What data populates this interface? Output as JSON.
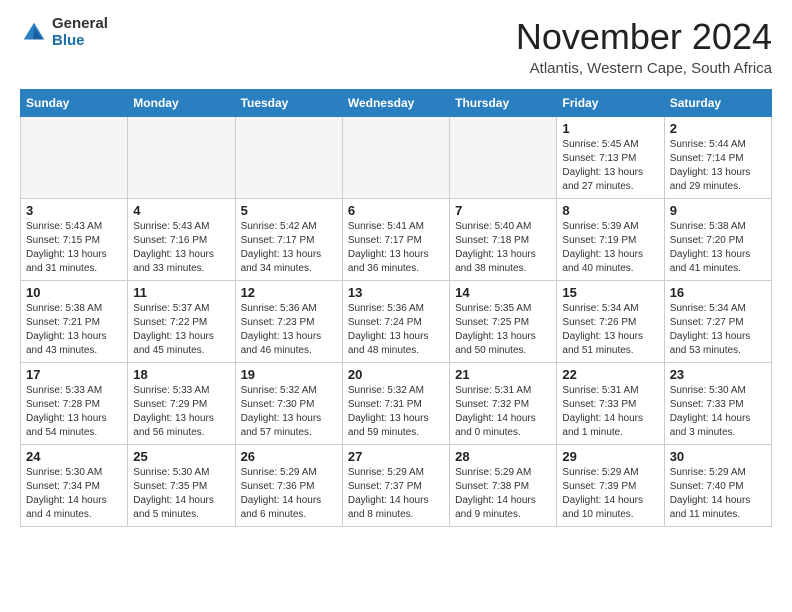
{
  "header": {
    "logo_general": "General",
    "logo_blue": "Blue",
    "month_title": "November 2024",
    "location": "Atlantis, Western Cape, South Africa"
  },
  "calendar": {
    "weekdays": [
      "Sunday",
      "Monday",
      "Tuesday",
      "Wednesday",
      "Thursday",
      "Friday",
      "Saturday"
    ],
    "weeks": [
      [
        {
          "day": "",
          "info": ""
        },
        {
          "day": "",
          "info": ""
        },
        {
          "day": "",
          "info": ""
        },
        {
          "day": "",
          "info": ""
        },
        {
          "day": "",
          "info": ""
        },
        {
          "day": "1",
          "info": "Sunrise: 5:45 AM\nSunset: 7:13 PM\nDaylight: 13 hours\nand 27 minutes."
        },
        {
          "day": "2",
          "info": "Sunrise: 5:44 AM\nSunset: 7:14 PM\nDaylight: 13 hours\nand 29 minutes."
        }
      ],
      [
        {
          "day": "3",
          "info": "Sunrise: 5:43 AM\nSunset: 7:15 PM\nDaylight: 13 hours\nand 31 minutes."
        },
        {
          "day": "4",
          "info": "Sunrise: 5:43 AM\nSunset: 7:16 PM\nDaylight: 13 hours\nand 33 minutes."
        },
        {
          "day": "5",
          "info": "Sunrise: 5:42 AM\nSunset: 7:17 PM\nDaylight: 13 hours\nand 34 minutes."
        },
        {
          "day": "6",
          "info": "Sunrise: 5:41 AM\nSunset: 7:17 PM\nDaylight: 13 hours\nand 36 minutes."
        },
        {
          "day": "7",
          "info": "Sunrise: 5:40 AM\nSunset: 7:18 PM\nDaylight: 13 hours\nand 38 minutes."
        },
        {
          "day": "8",
          "info": "Sunrise: 5:39 AM\nSunset: 7:19 PM\nDaylight: 13 hours\nand 40 minutes."
        },
        {
          "day": "9",
          "info": "Sunrise: 5:38 AM\nSunset: 7:20 PM\nDaylight: 13 hours\nand 41 minutes."
        }
      ],
      [
        {
          "day": "10",
          "info": "Sunrise: 5:38 AM\nSunset: 7:21 PM\nDaylight: 13 hours\nand 43 minutes."
        },
        {
          "day": "11",
          "info": "Sunrise: 5:37 AM\nSunset: 7:22 PM\nDaylight: 13 hours\nand 45 minutes."
        },
        {
          "day": "12",
          "info": "Sunrise: 5:36 AM\nSunset: 7:23 PM\nDaylight: 13 hours\nand 46 minutes."
        },
        {
          "day": "13",
          "info": "Sunrise: 5:36 AM\nSunset: 7:24 PM\nDaylight: 13 hours\nand 48 minutes."
        },
        {
          "day": "14",
          "info": "Sunrise: 5:35 AM\nSunset: 7:25 PM\nDaylight: 13 hours\nand 50 minutes."
        },
        {
          "day": "15",
          "info": "Sunrise: 5:34 AM\nSunset: 7:26 PM\nDaylight: 13 hours\nand 51 minutes."
        },
        {
          "day": "16",
          "info": "Sunrise: 5:34 AM\nSunset: 7:27 PM\nDaylight: 13 hours\nand 53 minutes."
        }
      ],
      [
        {
          "day": "17",
          "info": "Sunrise: 5:33 AM\nSunset: 7:28 PM\nDaylight: 13 hours\nand 54 minutes."
        },
        {
          "day": "18",
          "info": "Sunrise: 5:33 AM\nSunset: 7:29 PM\nDaylight: 13 hours\nand 56 minutes."
        },
        {
          "day": "19",
          "info": "Sunrise: 5:32 AM\nSunset: 7:30 PM\nDaylight: 13 hours\nand 57 minutes."
        },
        {
          "day": "20",
          "info": "Sunrise: 5:32 AM\nSunset: 7:31 PM\nDaylight: 13 hours\nand 59 minutes."
        },
        {
          "day": "21",
          "info": "Sunrise: 5:31 AM\nSunset: 7:32 PM\nDaylight: 14 hours\nand 0 minutes."
        },
        {
          "day": "22",
          "info": "Sunrise: 5:31 AM\nSunset: 7:33 PM\nDaylight: 14 hours\nand 1 minute."
        },
        {
          "day": "23",
          "info": "Sunrise: 5:30 AM\nSunset: 7:33 PM\nDaylight: 14 hours\nand 3 minutes."
        }
      ],
      [
        {
          "day": "24",
          "info": "Sunrise: 5:30 AM\nSunset: 7:34 PM\nDaylight: 14 hours\nand 4 minutes."
        },
        {
          "day": "25",
          "info": "Sunrise: 5:30 AM\nSunset: 7:35 PM\nDaylight: 14 hours\nand 5 minutes."
        },
        {
          "day": "26",
          "info": "Sunrise: 5:29 AM\nSunset: 7:36 PM\nDaylight: 14 hours\nand 6 minutes."
        },
        {
          "day": "27",
          "info": "Sunrise: 5:29 AM\nSunset: 7:37 PM\nDaylight: 14 hours\nand 8 minutes."
        },
        {
          "day": "28",
          "info": "Sunrise: 5:29 AM\nSunset: 7:38 PM\nDaylight: 14 hours\nand 9 minutes."
        },
        {
          "day": "29",
          "info": "Sunrise: 5:29 AM\nSunset: 7:39 PM\nDaylight: 14 hours\nand 10 minutes."
        },
        {
          "day": "30",
          "info": "Sunrise: 5:29 AM\nSunset: 7:40 PM\nDaylight: 14 hours\nand 11 minutes."
        }
      ]
    ]
  }
}
